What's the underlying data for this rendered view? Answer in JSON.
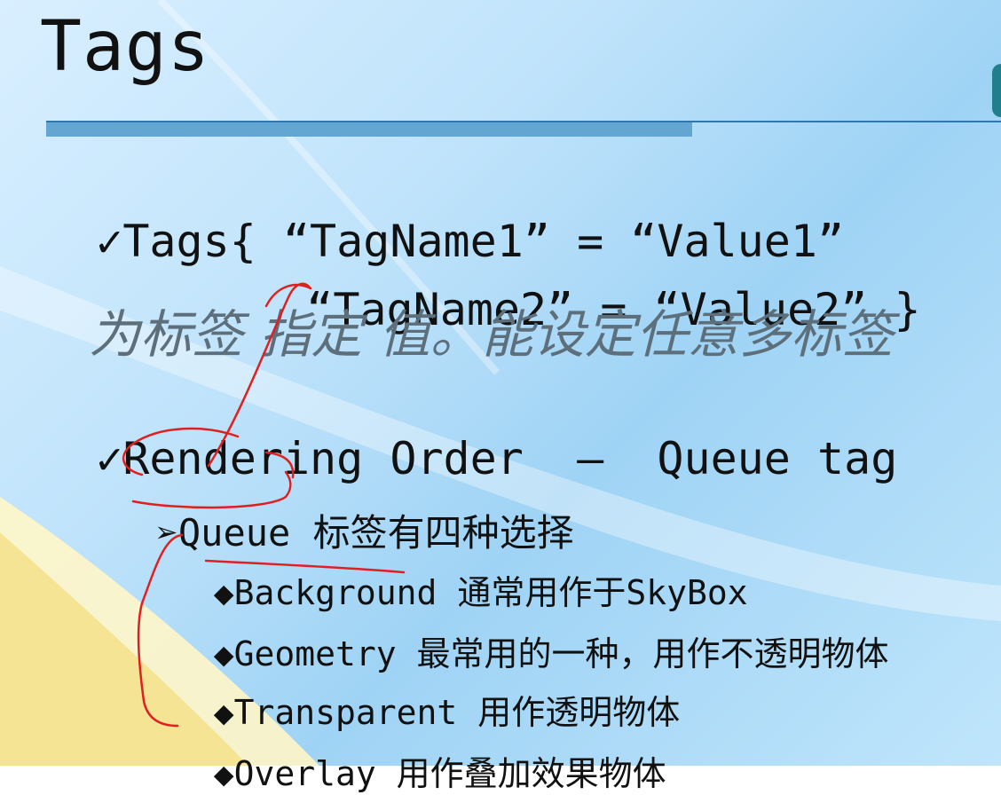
{
  "slide": {
    "title": "Tags",
    "bullets": [
      {
        "mark": "✓",
        "text": "Tags{ “TagName1” = “Value1”"
      },
      {
        "mark": "",
        "text": "“TagName2” = “Value2” }"
      },
      {
        "mark": "",
        "text": "为标签 指定 值。能设定任意多标签"
      },
      {
        "mark": "✓",
        "text": "Rendering Order  –  Queue tag"
      },
      {
        "mark": "➢",
        "text": "Queue 标签有四种选择"
      },
      {
        "mark": "◆",
        "text": "Background 通常用作于SkyBox"
      },
      {
        "mark": "◆",
        "text": "Geometry 最常用的一种，用作不透明物体"
      },
      {
        "mark": "◆",
        "text": "Transparent 用作透明物体"
      },
      {
        "mark": "◆",
        "text": "Overlay 用作叠加效果物体"
      }
    ]
  },
  "colors": {
    "background": "#bfe3fb",
    "rule": "#62a6d1",
    "annotation": "#e02020",
    "note_text": "#5d6f7b"
  }
}
